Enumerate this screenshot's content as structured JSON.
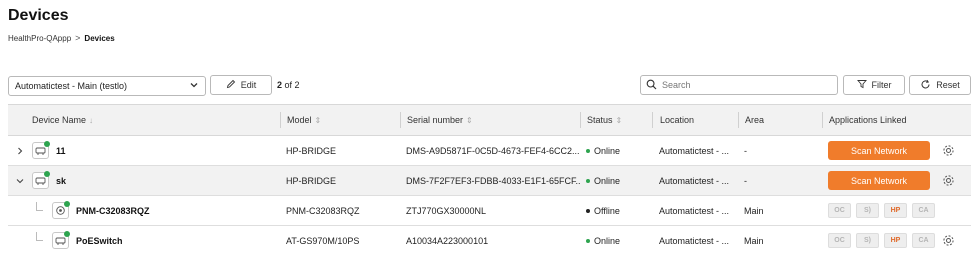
{
  "page": {
    "title": "Devices"
  },
  "breadcrumb": {
    "parent": "HealthPro-QAppp",
    "separator": ">",
    "current": "Devices"
  },
  "toolbar": {
    "site_select": "Automatictest - Main (testlo)",
    "edit_label": "Edit",
    "count_current": "2",
    "count_sep": "of 2",
    "search_placeholder": "Search",
    "filter_label": "Filter",
    "reset_label": "Reset"
  },
  "table": {
    "headers": {
      "name": "Device Name",
      "model": "Model",
      "serial": "Serial number",
      "status": "Status",
      "location": "Location",
      "area": "Area",
      "apps": "Applications Linked"
    },
    "rows": [
      {
        "name": "11",
        "model": "HP-BRIDGE",
        "serial": "DMS-A9D5871F-0C5D-4673-FEF4-6CC2...",
        "status": "Online",
        "location": "Automatictest - ...",
        "area": "-",
        "action": "Scan Network"
      },
      {
        "name": "sk",
        "model": "HP-BRIDGE",
        "serial": "DMS-7F2F7EF3-FDBB-4033-E1F1-65FCF...",
        "status": "Online",
        "location": "Automatictest - ...",
        "area": "-",
        "action": "Scan Network"
      },
      {
        "name": "PNM-C32083RQZ",
        "model": "PNM-C32083RQZ",
        "serial": "ZTJ770GX30000NL",
        "status": "Offline",
        "location": "Automatictest - ...",
        "area": "Main",
        "apps": [
          "OC",
          "S)",
          "HP",
          "CA"
        ]
      },
      {
        "name": "PoESwitch",
        "model": "AT-GS970M/10PS",
        "serial": "A10034A223000101",
        "status": "Online",
        "location": "Automatictest - ...",
        "area": "Main",
        "apps": [
          "OC",
          "S)",
          "HP",
          "CA"
        ]
      }
    ]
  },
  "colors": {
    "accent": "#f07c2b",
    "online": "#2ea44f",
    "offline": "#222222",
    "header_bg": "#f2f2f2"
  }
}
